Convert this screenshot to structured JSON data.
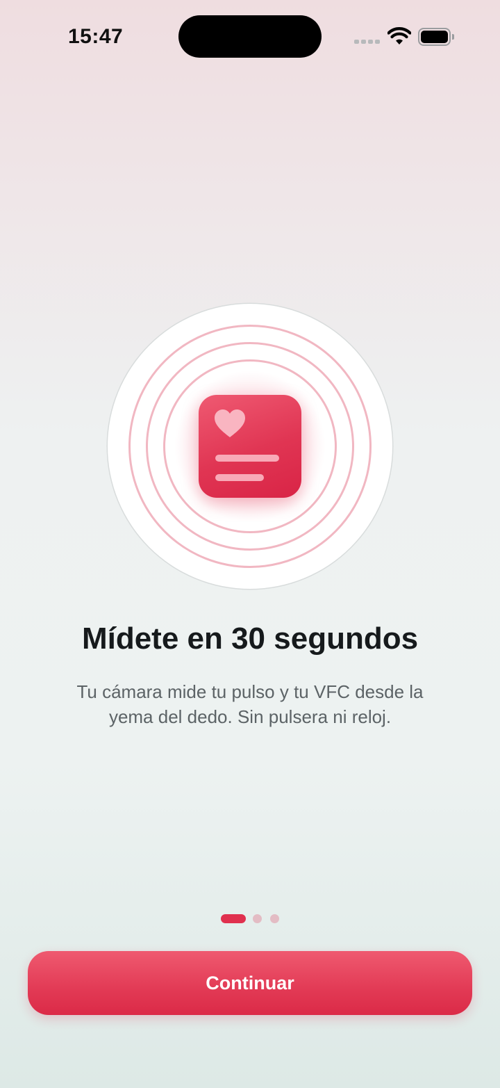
{
  "status_bar": {
    "time": "15:47"
  },
  "onboarding": {
    "title": "Mídete en 30 segundos",
    "subtitle": "Tu cámara mide tu pulso y tu VFC desde la yema del dedo. Sin pulsera ni reloj.",
    "page_index": 1,
    "page_count": 3
  },
  "actions": {
    "continue_label": "Continuar"
  },
  "colors": {
    "accent": "#e0304e",
    "ring": "#f1b7c2",
    "inactive_dot": "#e3bcc4"
  },
  "icons": {
    "illustration": "heart-report-icon"
  }
}
